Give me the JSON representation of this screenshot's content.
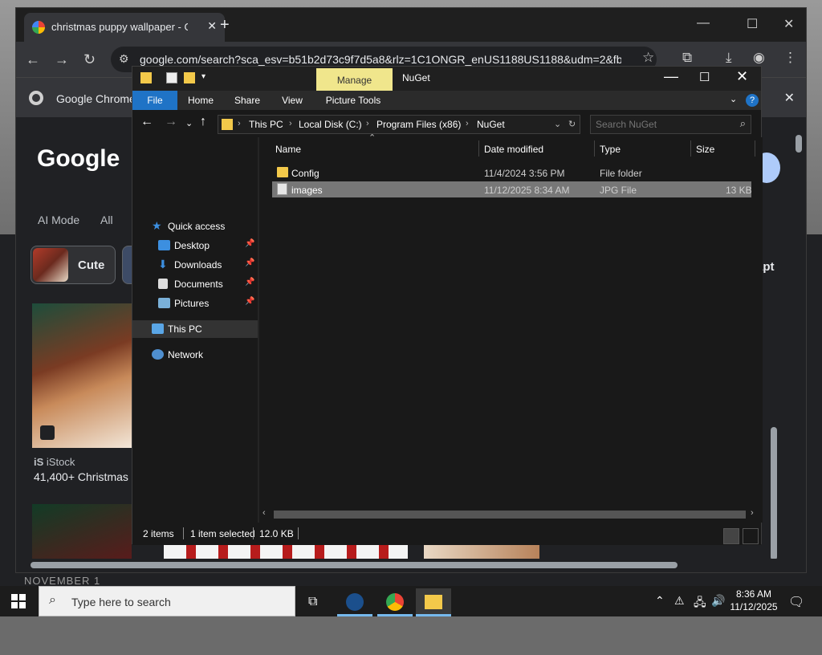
{
  "chrome": {
    "tab_title": "christmas puppy wallpaper - Go",
    "url": "google.com/search?sca_esv=b51b2d73c9f7d5a8&rlz=1C1ONGR_enUS1188US1188&udm=2&fbs...",
    "infobar_text": "Google Chrome",
    "google_logo": "Google",
    "tabs": [
      "AI Mode",
      "All"
    ],
    "chip_label": "Cute",
    "right_chip": "apt",
    "source": "iStock",
    "source_mark": "iS",
    "caption": "41,400+ Christmas",
    "below_text": "NOVEMBER 1"
  },
  "explorer": {
    "manage_label": "Manage",
    "window_title": "NuGet",
    "ribbon_tabs": [
      "File",
      "Home",
      "Share",
      "View",
      "Picture Tools"
    ],
    "breadcrumb": [
      "This PC",
      "Local Disk (C:)",
      "Program Files (x86)",
      "NuGet"
    ],
    "search_placeholder": "Search NuGet",
    "nav": {
      "quick_access": "Quick access",
      "desktop": "Desktop",
      "downloads": "Downloads",
      "documents": "Documents",
      "pictures": "Pictures",
      "this_pc": "This PC",
      "network": "Network"
    },
    "columns": [
      "Name",
      "Date modified",
      "Type",
      "Size"
    ],
    "files": [
      {
        "name": "Config",
        "date": "11/4/2024 3:56 PM",
        "type": "File folder",
        "size": ""
      },
      {
        "name": "images",
        "date": "11/12/2025 8:34 AM",
        "type": "JPG File",
        "size": "13 KB"
      }
    ],
    "status": {
      "items": "2 items",
      "selected": "1 item selected",
      "size": "12.0 KB"
    }
  },
  "taskbar": {
    "search_placeholder": "Type here to search",
    "time": "8:36 AM",
    "date": "11/12/2025"
  },
  "colors": {
    "manage_highlight": "#f0e68c",
    "file_tab": "#1f73c6",
    "folder": "#f3c94a"
  }
}
